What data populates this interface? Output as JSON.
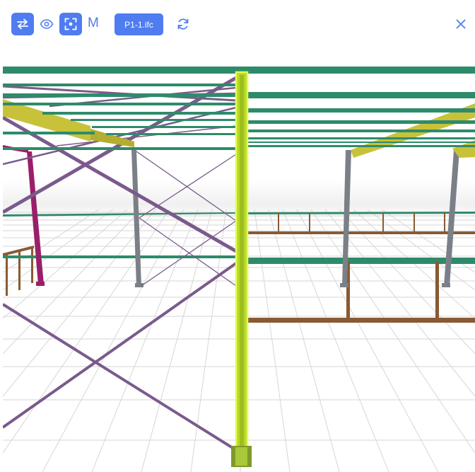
{
  "toolbar": {
    "swap_icon": "swap-arrows-icon",
    "visibility_icon": "eye-icon",
    "focus_icon": "focus-frame-icon",
    "mode_label": "M",
    "file_name": "P1-1.ifc",
    "reload_icon": "refresh-icon",
    "close_icon": "close-icon"
  },
  "colors": {
    "accent": "#4f7cf1",
    "beam_green": "#2e8b6a",
    "rafter_yellow": "#c8c23a",
    "brace_purple": "#7a5a8c",
    "column_grey": "#7b8088",
    "column_magenta": "#9a1f6a",
    "rail_brown": "#8a5a32",
    "selected_highlight": "#d8f23a"
  }
}
